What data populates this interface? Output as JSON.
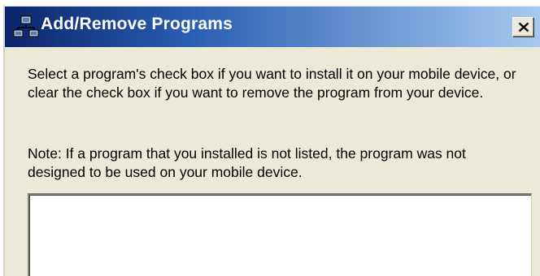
{
  "window": {
    "title": "Add/Remove Programs",
    "title_icon": "install-programs-icon",
    "close_label": "X"
  },
  "content": {
    "instructions": "Select a program's check box if you want to install it on your mobile device, or clear the check box if you want to remove the program from your device.",
    "note": "Note:  If a program that you installed is not listed, the program was not designed to be used on your mobile device."
  },
  "program_list": {
    "items": []
  },
  "colors": {
    "titlebar_start": "#0a246a",
    "titlebar_end": "#a6caf0",
    "dialog_background": "#ece9d8",
    "list_background": "#ffffff"
  }
}
